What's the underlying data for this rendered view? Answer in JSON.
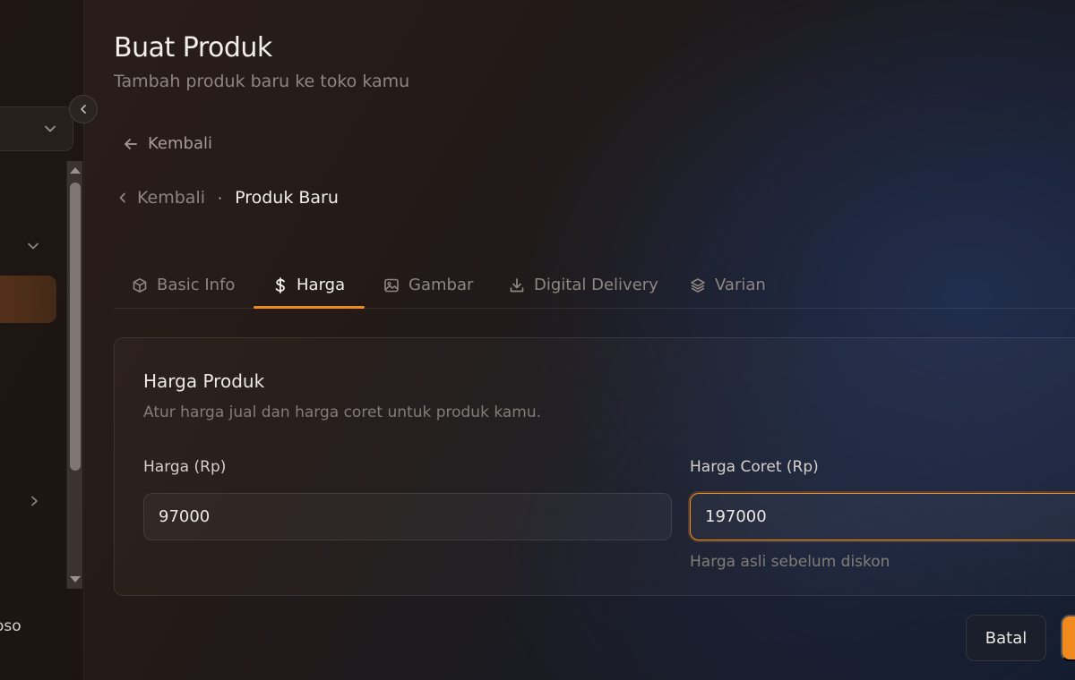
{
  "sidebar": {
    "user_name_fragment": "oso",
    "select_chevron_icon": "chevron-down-icon",
    "group_chevron_icon": "chevron-down-icon",
    "submenu_chevron_icon": "chevron-right-icon",
    "collapse_icon": "chevron-left-icon"
  },
  "header": {
    "title": "Buat Produk",
    "subtitle": "Tambah produk baru ke toko kamu"
  },
  "back_link": {
    "label": "Kembali",
    "icon": "arrow-left-icon"
  },
  "breadcrumb": {
    "back_label": "Kembali",
    "separator": "·",
    "current": "Produk Baru"
  },
  "tabs": [
    {
      "label": "Basic Info",
      "icon": "cube-icon",
      "active": false
    },
    {
      "label": "Harga",
      "icon": "dollar-icon",
      "active": true
    },
    {
      "label": "Gambar",
      "icon": "image-icon",
      "active": false
    },
    {
      "label": "Digital Delivery",
      "icon": "download-icon",
      "active": false
    },
    {
      "label": "Varian",
      "icon": "layers-icon",
      "active": false
    }
  ],
  "pricing_card": {
    "title": "Harga Produk",
    "description": "Atur harga jual dan harga coret untuk produk kamu.",
    "price": {
      "label": "Harga (Rp)",
      "value": "97000"
    },
    "strike_price": {
      "label": "Harga Coret (Rp)",
      "value": "197000",
      "hint": "Harga asli sebelum diskon"
    }
  },
  "footer": {
    "cancel_label": "Batal"
  },
  "colors": {
    "accent": "#f08a1e",
    "text_primary": "#f2eee9",
    "text_muted": "#8e8680"
  }
}
